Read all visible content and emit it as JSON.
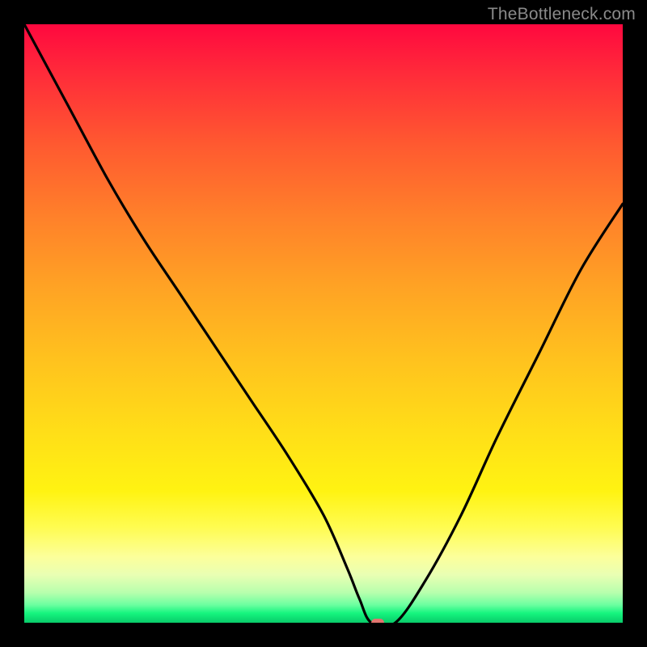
{
  "watermark": {
    "text": "TheBottleneck.com"
  },
  "colors": {
    "marker_bg": "#e0746e",
    "curve_stroke": "#000000",
    "frame_bg": "#000000"
  },
  "chart_data": {
    "type": "line",
    "title": "",
    "xlabel": "",
    "ylabel": "",
    "xlim": [
      0,
      100
    ],
    "ylim": [
      0,
      100
    ],
    "grid": false,
    "gradient": {
      "top": "#ff083f",
      "middle": "#ffde18",
      "bottom": "#0acb69"
    },
    "series": [
      {
        "name": "bottleneck-curve",
        "x": [
          0,
          7,
          14,
          20,
          26,
          32,
          38,
          44,
          50,
          54,
          56,
          58,
          62,
          67,
          73,
          79,
          86,
          93,
          100
        ],
        "values": [
          100,
          87,
          74,
          64,
          55,
          46,
          37,
          28,
          18,
          9,
          4,
          0,
          0,
          7,
          18,
          31,
          45,
          59,
          70
        ]
      }
    ],
    "marker": {
      "x": 59,
      "y": 0,
      "label": ""
    }
  }
}
